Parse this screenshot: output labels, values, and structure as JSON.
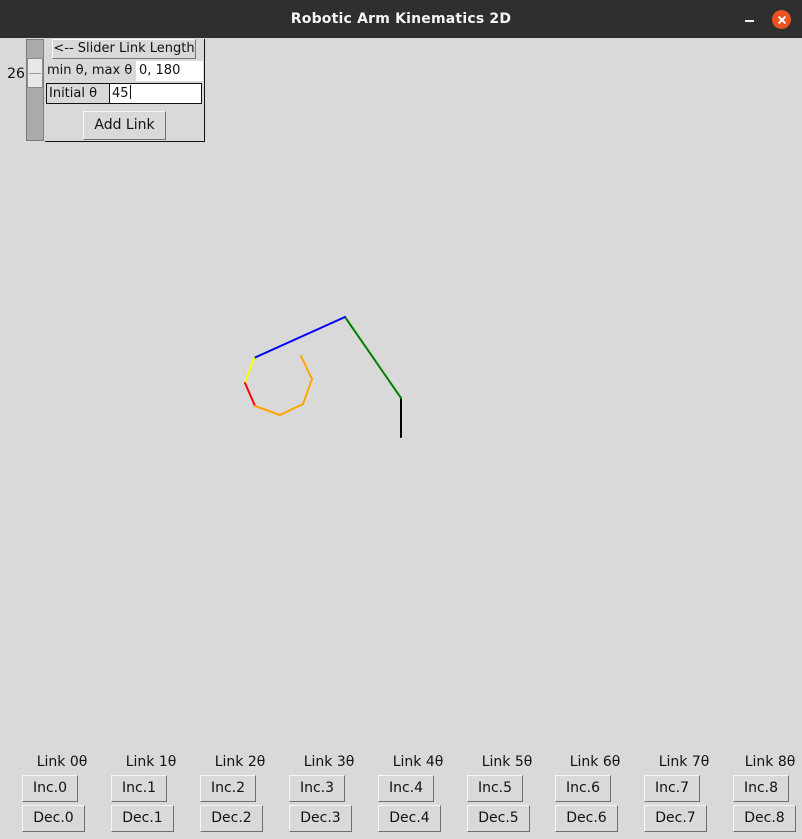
{
  "window": {
    "title": "Robotic Arm Kinematics 2D",
    "accent_close": "#e95420"
  },
  "controls": {
    "slider_value": "26",
    "slider_label": "<-- Slider Link Length",
    "minmax_label": "min θ, max θ",
    "minmax_value": "0, 180",
    "initial_label": "Initial θ",
    "initial_value": "45",
    "add_link_label": "Add Link"
  },
  "arm": {
    "segment_colors": [
      "#000000",
      "#008000",
      "#0000ff",
      "#ffff00",
      "#ff0000",
      "#ffa500"
    ]
  },
  "joints": [
    {
      "label": "Link 0θ",
      "inc": "Inc.0",
      "dec": "Dec.0"
    },
    {
      "label": "Link 1θ",
      "inc": "Inc.1",
      "dec": "Dec.1"
    },
    {
      "label": "Link 2θ",
      "inc": "Inc.2",
      "dec": "Dec.2"
    },
    {
      "label": "Link 3θ",
      "inc": "Inc.3",
      "dec": "Dec.3"
    },
    {
      "label": "Link 4θ",
      "inc": "Inc.4",
      "dec": "Dec.4"
    },
    {
      "label": "Link 5θ",
      "inc": "Inc.5",
      "dec": "Dec.5"
    },
    {
      "label": "Link 6θ",
      "inc": "Inc.6",
      "dec": "Dec.6"
    },
    {
      "label": "Link 7θ",
      "inc": "Inc.7",
      "dec": "Dec.7"
    },
    {
      "label": "Link 8θ",
      "inc": "Inc.8",
      "dec": "Dec.8"
    }
  ]
}
